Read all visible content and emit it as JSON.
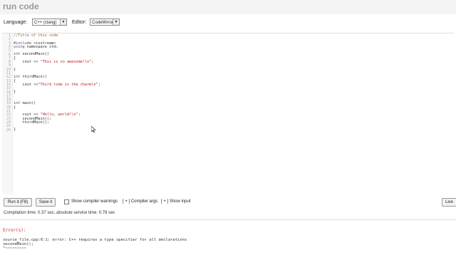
{
  "app": {
    "title": "run code"
  },
  "toolbar": {
    "language_label": "Language:",
    "language_value": "C++ (clang)",
    "editor_label": "Editor:",
    "editor_value": "CodeMirror"
  },
  "editor": {
    "line_numbers": [
      "1",
      "2",
      "3",
      "4",
      "5",
      "6",
      "7",
      "8",
      "9",
      "10",
      "11",
      "12",
      "13",
      "14",
      "15",
      "16",
      "17",
      "18",
      "19",
      "20",
      "21",
      "22",
      "23",
      "24",
      "25",
      "26"
    ],
    "lines": [
      "//Title of this code",
      "",
      "#include <iostream>",
      "using namespace std;",
      "",
      "int secondMain()",
      "{",
      "    cout << \"This is so awesome!\\n\";",
      "",
      "}",
      "",
      "int thirdMain()",
      "{",
      "    cout <<\"Third time is the charm\\n\";",
      "",
      "}",
      "",
      "",
      "int main()",
      "{",
      "",
      "    cout << \"Hello, world!\\n\";",
      "    secondMain();",
      "    thirdMain();",
      "",
      "}"
    ]
  },
  "actions": {
    "run_label": "Run it (F8)",
    "save_label": "Save it",
    "warnings_label": "Show compiler warnings",
    "compiler_args_label": "[ + ] Compiler args",
    "show_input_label": "[ + ] Show input",
    "live_label": "Live"
  },
  "status": {
    "compile_text": "Compilation time: 0.37 sec, absolute service time: 0.78 sec"
  },
  "output": {
    "error_label": "Error(s):",
    "error_lines": [
      "source_file.cpp:6:1: error: C++ requires a type specifier for all declarations",
      "secondMain();",
      "^~~~~~~~~~"
    ]
  }
}
